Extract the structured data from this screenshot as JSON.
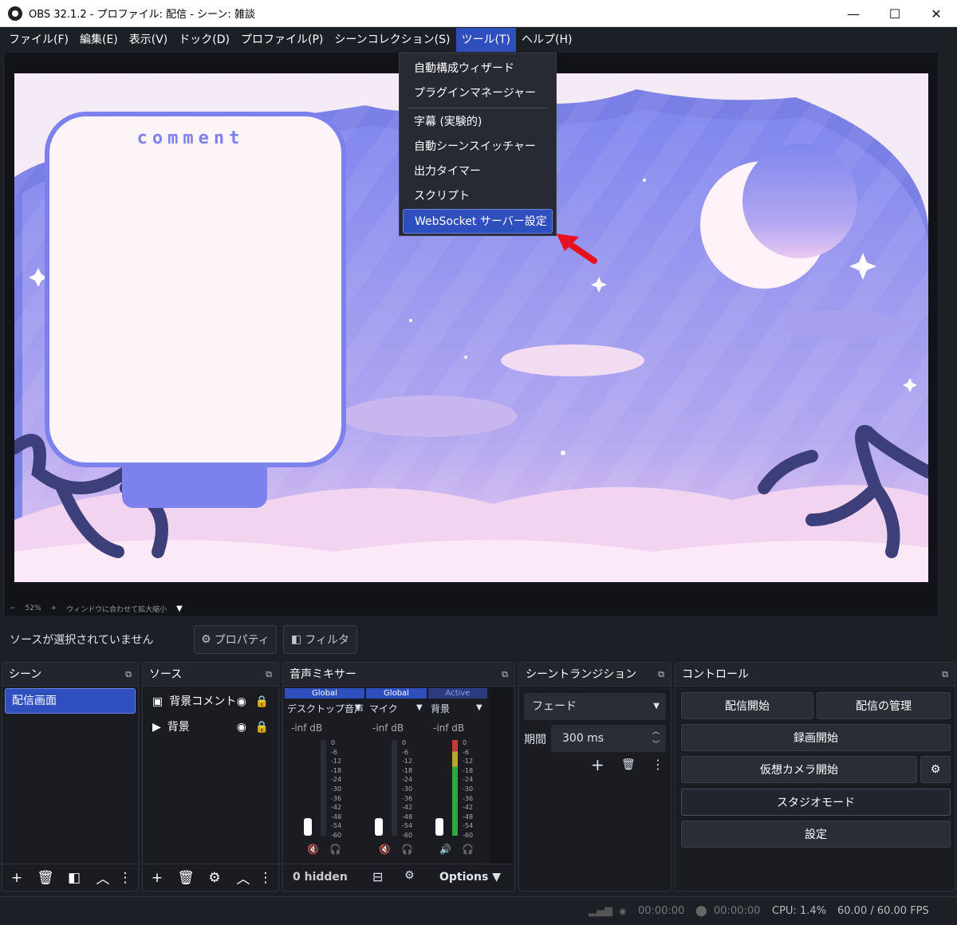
{
  "window": {
    "title": "OBS 32.1.2 - プロファイル: 配信 - シーン: 雑談",
    "minimize": "—",
    "maximize": "☐",
    "close": "✕"
  },
  "menu": [
    "ファイル(F)",
    "編集(E)",
    "表示(V)",
    "ドック(D)",
    "プロファイル(P)",
    "シーンコレクション(S)",
    "ツール(T)",
    "ヘルプ(H)"
  ],
  "tools_menu": {
    "group1": [
      "自動構成ウィザード",
      "プラグインマネージャー"
    ],
    "group2": [
      "字幕 (実験的)",
      "自動シーンスイッチャー",
      "出力タイマー",
      "スクリプト"
    ],
    "highlighted": "WebSocket サーバー設定"
  },
  "preview": {
    "overlay_text": "comment"
  },
  "zoom": {
    "minus": "−",
    "level": "52%",
    "plus": "+",
    "fit": "ウィンドウに合わせて拡大縮小"
  },
  "source_bar": {
    "no_source": "ソースが選択されていません",
    "properties": "プロパティ",
    "filters": "フィルタ"
  },
  "scenes": {
    "title": "シーン",
    "items": [
      "配信画面"
    ]
  },
  "sources": {
    "title": "ソース",
    "items": [
      "背景コメント",
      "背景"
    ]
  },
  "mixer": {
    "title": "音声ミキサー",
    "channels": [
      {
        "tag": "Global",
        "name": "デスクトップ音声",
        "level": "-inf dB"
      },
      {
        "tag": "Global",
        "name": "マイク",
        "level": "-inf dB"
      },
      {
        "tag": "Active",
        "name": "背景",
        "level": "-inf dB"
      }
    ],
    "ticks": [
      "0",
      "-6",
      "-12",
      "-18",
      "-24",
      "-30",
      "-36",
      "-42",
      "-48",
      "-54",
      "-60"
    ],
    "hidden": "0 hidden",
    "options": "Options"
  },
  "transitions": {
    "title": "シーントランジション",
    "type": "フェード",
    "duration_label": "期間",
    "duration": "300 ms"
  },
  "controls": {
    "title": "コントロール",
    "start_stream": "配信開始",
    "manage_stream": "配信の管理",
    "start_record": "録画開始",
    "virtual_cam": "仮想カメラ開始",
    "studio_mode": "スタジオモード",
    "settings": "設定"
  },
  "status": {
    "stream_time": "00:00:00",
    "record_time": "00:00:00",
    "cpu": "CPU: 1.4%",
    "fps": "60.00 / 60.00 FPS"
  },
  "colors": {
    "accent": "#2f4fbe",
    "sky": "#8a8ff0",
    "panel": "#1a1c22"
  }
}
